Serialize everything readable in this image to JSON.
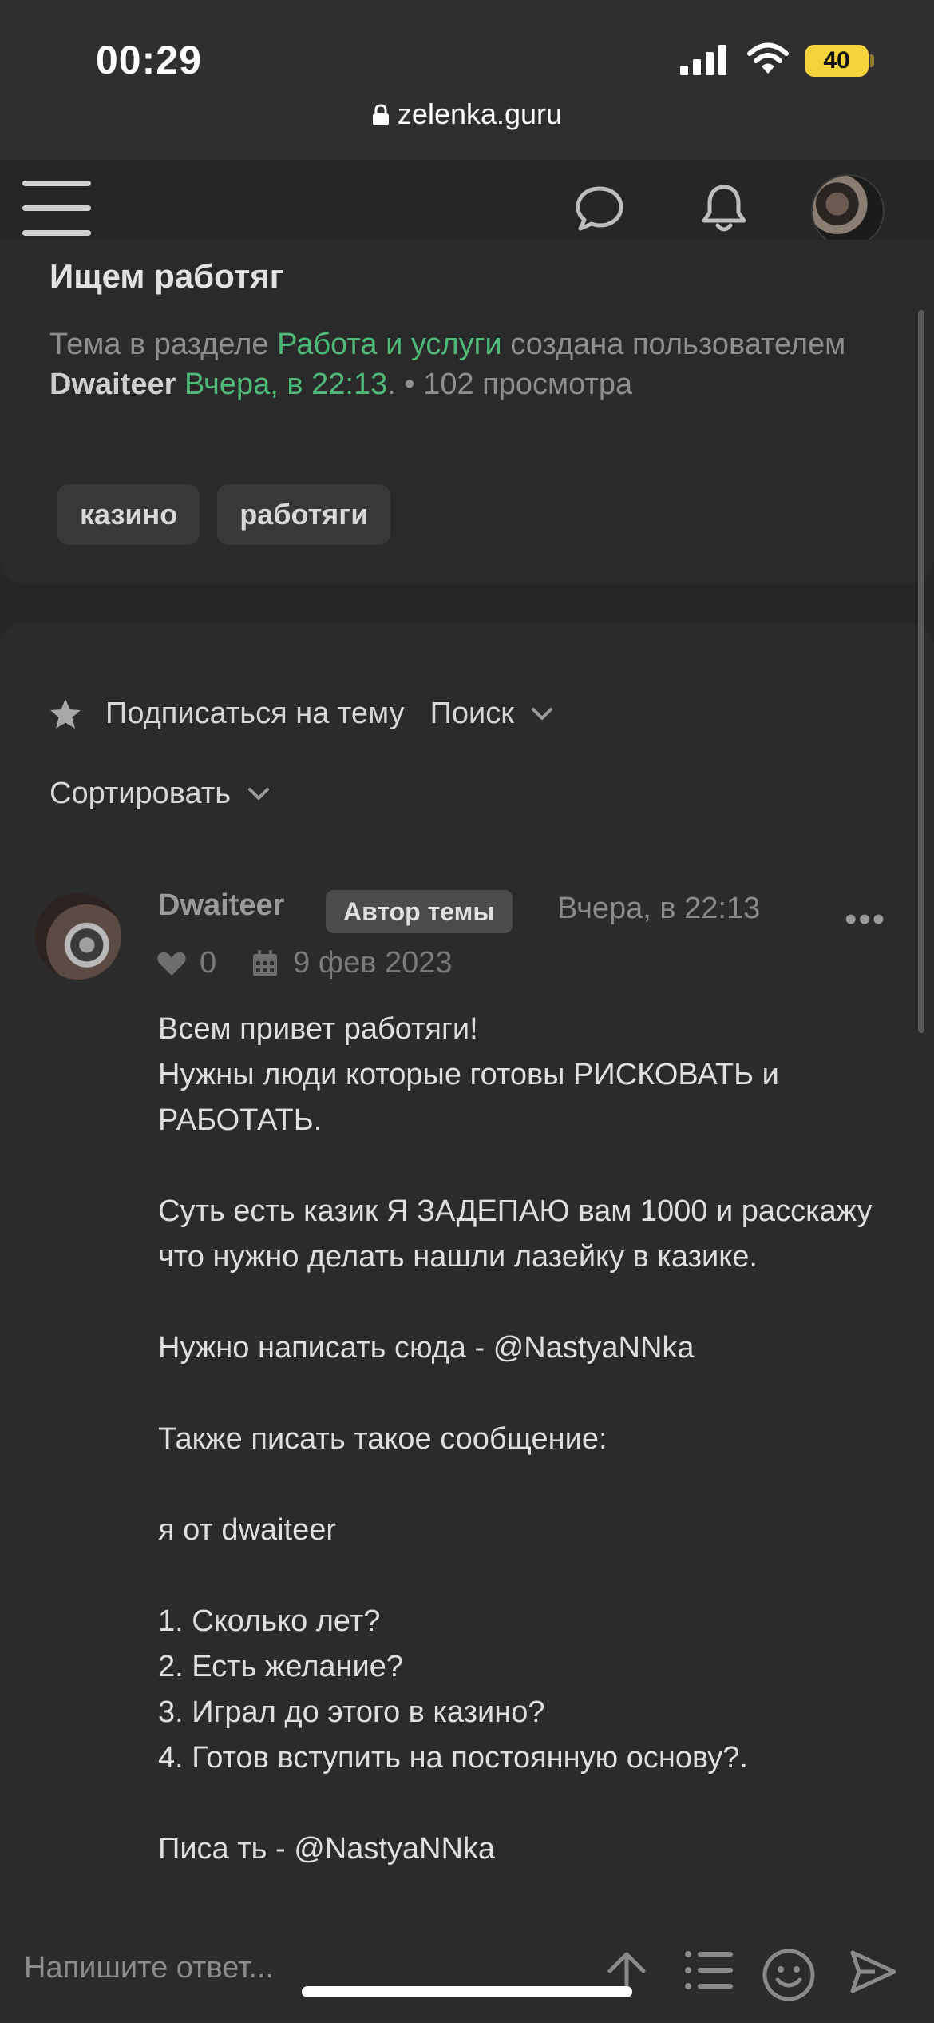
{
  "status": {
    "time": "00:29",
    "battery": "40",
    "url": "zelenka.guru"
  },
  "header": {
    "menu_icon": "hamburger-icon",
    "chat_icon": "chat-bubble-icon",
    "bell_icon": "bell-icon"
  },
  "thread": {
    "title": "Ищем работяг",
    "meta_prefix": "Тема в разделе",
    "section": "Работа и услуги",
    "meta_mid": "создана пользователем",
    "author": "Dwaiteer",
    "date": "Вчера, в 22:13",
    "dot": ". •",
    "views": "102 просмотра",
    "tags": [
      "казино",
      "работяги"
    ]
  },
  "actions": {
    "subscribe": "Подписаться на тему",
    "search": "Поиск",
    "sort": "Сортировать"
  },
  "post": {
    "author": "Dwaiteer",
    "badge": "Автор темы",
    "time": "Вчера, в 22:13",
    "more": "•••",
    "likes": "0",
    "reg_date": "9 фев 2023",
    "lines": [
      "Всем привет работяги!",
      "Нужны люди которые готовы РИСКОВАТЬ и РАБОТАТЬ.",
      "",
      "Суть есть казик Я ЗАДЕПАЮ вам 1000 и расскажу что нужно делать нашли лазейку в казике.",
      "",
      "Нужно написать сюда - @NastyaNNka",
      "",
      "Также писать такое сообщение:",
      "",
      "я от dwaiteer",
      "",
      "1. Сколько лет?",
      "2. Есть желание?",
      "3. Играл до этого в казино?",
      "4. Готов вступить на постоянную основу?.",
      "",
      "Писа ть - @NastyaNNka"
    ]
  },
  "reply": {
    "placeholder": "Напишите ответ..."
  },
  "colors": {
    "accent_green": "#4fb97a",
    "background": "#262626",
    "battery": "#f5d13a"
  }
}
